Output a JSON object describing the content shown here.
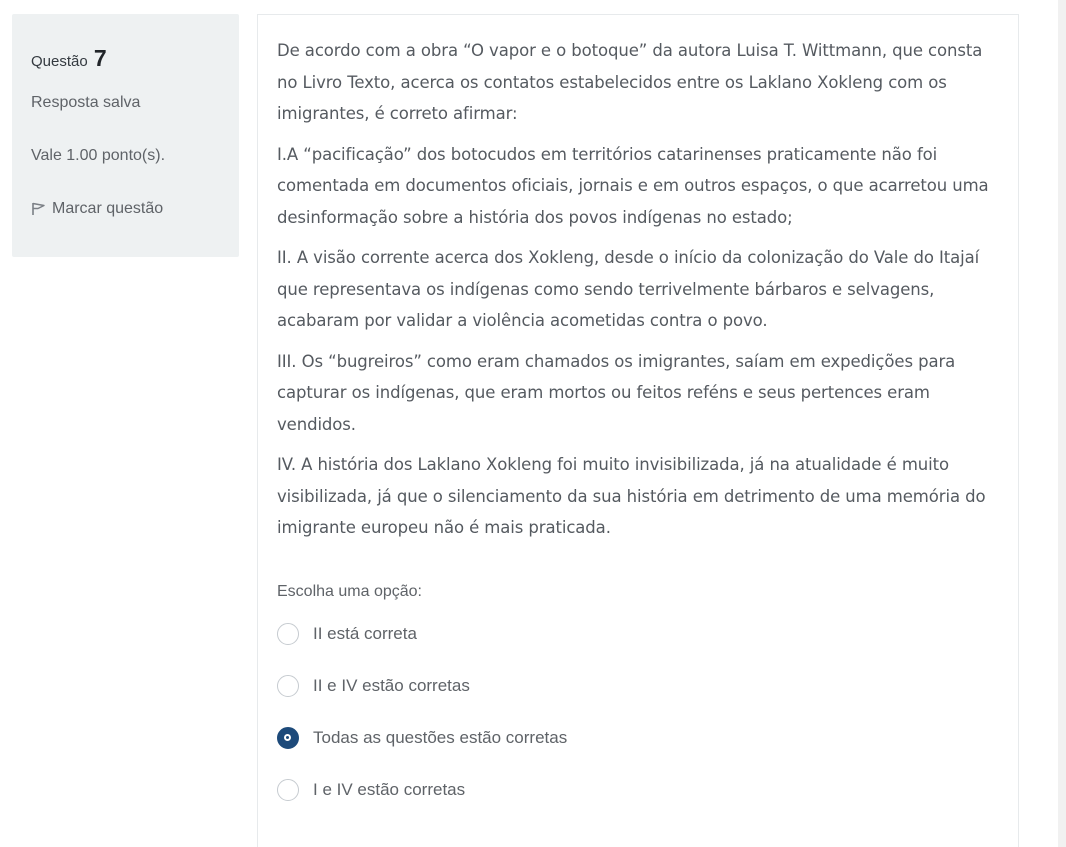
{
  "info": {
    "question_label": "Questão",
    "question_number": "7",
    "state": "Resposta salva",
    "grade": "Vale 1.00 ponto(s).",
    "flag_label": "Marcar questão"
  },
  "question": {
    "paragraphs": [
      "De acordo com a obra “O vapor e o botoque” da autora Luisa T. Wittmann, que consta no Livro Texto, acerca os contatos estabelecidos entre os Laklano Xokleng com os imigrantes, é correto afirmar:",
      "I.A “pacificação” dos botocudos em territórios catarinenses praticamente não foi comentada em documentos oficiais, jornais e em outros espaços, o que acarretou uma desinformação sobre a história dos povos indígenas no estado;",
      "II. A visão corrente acerca dos Xokleng, desde o início da colonização do Vale do Itajaí que representava os indígenas como sendo terrivelmente bárbaros e selvagens, acabaram por validar a violência acometidas contra o povo.",
      "III. Os “bugreiros” como eram chamados os imigrantes, saíam em expedições para capturar os indígenas, que eram mortos ou feitos reféns e seus pertences eram vendidos.",
      "IV. A história dos Laklano Xokleng foi muito invisibilizada, já na atualidade é muito visibilizada, já que o silenciamento da sua história em detrimento de uma memória do imigrante europeu não é mais praticada."
    ],
    "prompt": "Escolha uma opção:",
    "options": [
      {
        "label": "II está correta",
        "selected": false
      },
      {
        "label": "II e IV estão corretas",
        "selected": false
      },
      {
        "label": "Todas as questões estão corretas",
        "selected": true
      },
      {
        "label": "I e IV estão corretas",
        "selected": false
      }
    ]
  },
  "colors": {
    "info_bg": "#eef1f2",
    "radio_checked": "#1d4a7a",
    "text": "#555a60"
  }
}
